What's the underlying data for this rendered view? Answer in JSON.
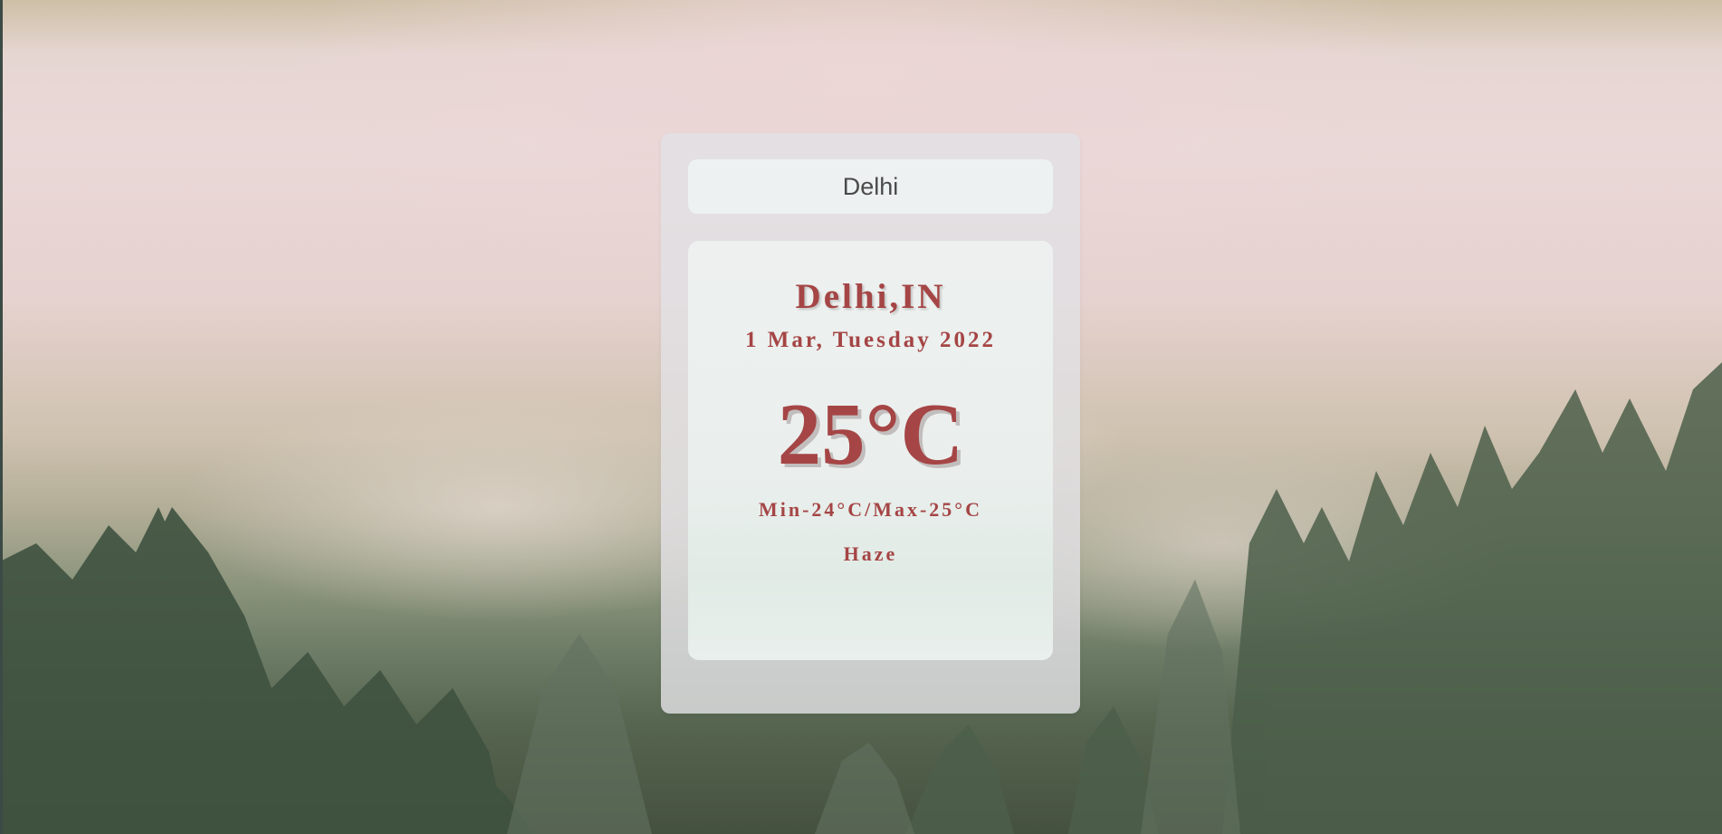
{
  "search": {
    "value": "Delhi"
  },
  "weather": {
    "location": "Delhi,IN",
    "date": "1 Mar, Tuesday 2022",
    "temperature": "25°C",
    "min_max": "Min-24°C/Max-25°C",
    "condition": "Haze"
  },
  "colors": {
    "accent": "#a54545",
    "panel": "#e2e0e4",
    "input_bg": "#edf1f1"
  }
}
